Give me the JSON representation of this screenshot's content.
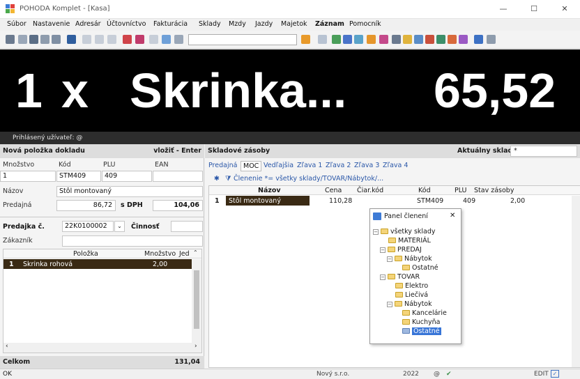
{
  "window": {
    "title": "POHODA Komplet - [Kasa]",
    "minimize": "—",
    "maximize": "☐",
    "close": "✕"
  },
  "menu": [
    "Súbor",
    "Nastavenie",
    "Adresár",
    "Účtovníctvo",
    "Fakturácia",
    "Sklady",
    "Mzdy",
    "Jazdy",
    "Majetok",
    "Záznam",
    "Pomocník"
  ],
  "banner": {
    "qty": "1",
    "x": "x",
    "name": "Skrinka...",
    "price": "65,52"
  },
  "user": {
    "label": "Prihlásený užívateľ: @"
  },
  "new_item": {
    "title": "Nová položka dokladu",
    "hint": "vložiť - Enter",
    "qty_label": "Množstvo",
    "code_label": "Kód",
    "plu_label": "PLU",
    "ean_label": "EAN",
    "qty": "1",
    "code": "STM409",
    "plu": "409",
    "ean": "",
    "name_label": "Názov",
    "name": "Stôl montovaný",
    "sale_label": "Predajná",
    "sale": "86,72",
    "vat_label": "s DPH",
    "sale_vat": "104,06"
  },
  "receipt": {
    "label": "Predajka č.",
    "number": "22K0100002",
    "activity_label": "Činnosť",
    "activity": "",
    "customer_label": "Zákazník",
    "customer": "",
    "col_item": "Položka",
    "col_qty": "Množstvo",
    "col_unit": "Jed",
    "rows": [
      {
        "no": "1",
        "item": "Skrinka rohová",
        "qty": "2,00",
        "unit": ""
      }
    ]
  },
  "total": {
    "label": "Celkom",
    "value": "131,04"
  },
  "stock": {
    "title": "Skladové zásoby",
    "current_label": "Aktuálny sklad",
    "current_value": "*",
    "tabs": [
      "Predajná",
      "MOC",
      "Vedľajšia",
      "Zľava 1",
      "Zľava 2",
      "Zľava 3",
      "Zľava 4"
    ],
    "filter": "Členenie *= všetky sklady/TOVAR/Nábytok/...",
    "columns": [
      "Názov",
      "Cena",
      "Čiar.kód",
      "Kód",
      "PLU",
      "Stav zásoby"
    ],
    "rows": [
      {
        "no": "1",
        "name": "Stôl montovaný",
        "price": "110,28",
        "barcode": "",
        "code": "STM409",
        "plu": "409",
        "stock": "2,00"
      }
    ]
  },
  "panel": {
    "title": "Panel členení",
    "close": "✕",
    "nodes": [
      "všetky sklady",
      "MATERIÁL",
      "PREDAJ",
      "Nábytok",
      "Ostatné",
      "TOVAR",
      "Elektro",
      "Liečivá",
      "Nábytok",
      "Kancelárie",
      "Kuchyňa",
      "Ostatné"
    ]
  },
  "status": {
    "left": "OK",
    "company": "Nový s.r.o.",
    "year": "2022",
    "at": "@",
    "mode": "EDIT"
  },
  "colors": {
    "accent": "#3a2a14",
    "banner_bg": "#000000",
    "selection": "#3875d7"
  }
}
